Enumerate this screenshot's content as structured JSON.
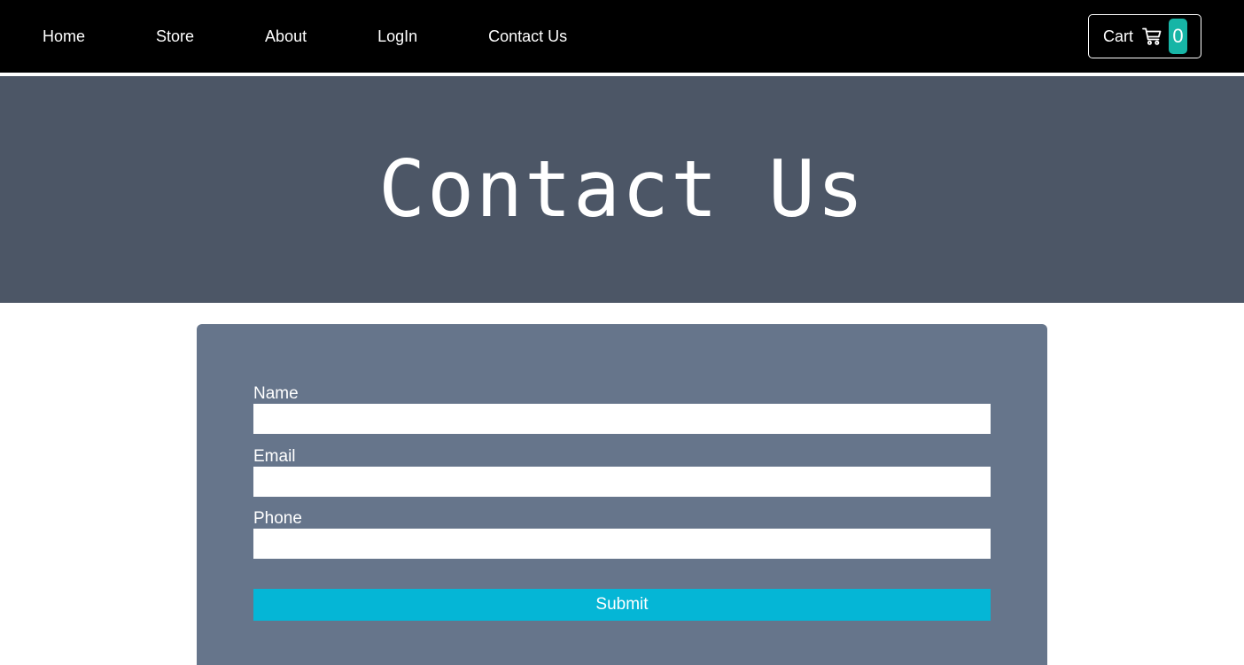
{
  "nav": {
    "links": [
      "Home",
      "Store",
      "About",
      "LogIn",
      "Contact Us"
    ]
  },
  "cart": {
    "label": "Cart",
    "icon": "shopping-cart-icon",
    "count": "0",
    "count_color": "#17b5a6"
  },
  "hero": {
    "title": "Contact Us",
    "background": "#4c5666"
  },
  "form": {
    "card_background": "#66758b",
    "fields": [
      {
        "label": "Name",
        "value": ""
      },
      {
        "label": "Email",
        "value": ""
      },
      {
        "label": "Phone",
        "value": ""
      }
    ],
    "submit_label": "Submit",
    "submit_color": "#05b6d6"
  }
}
